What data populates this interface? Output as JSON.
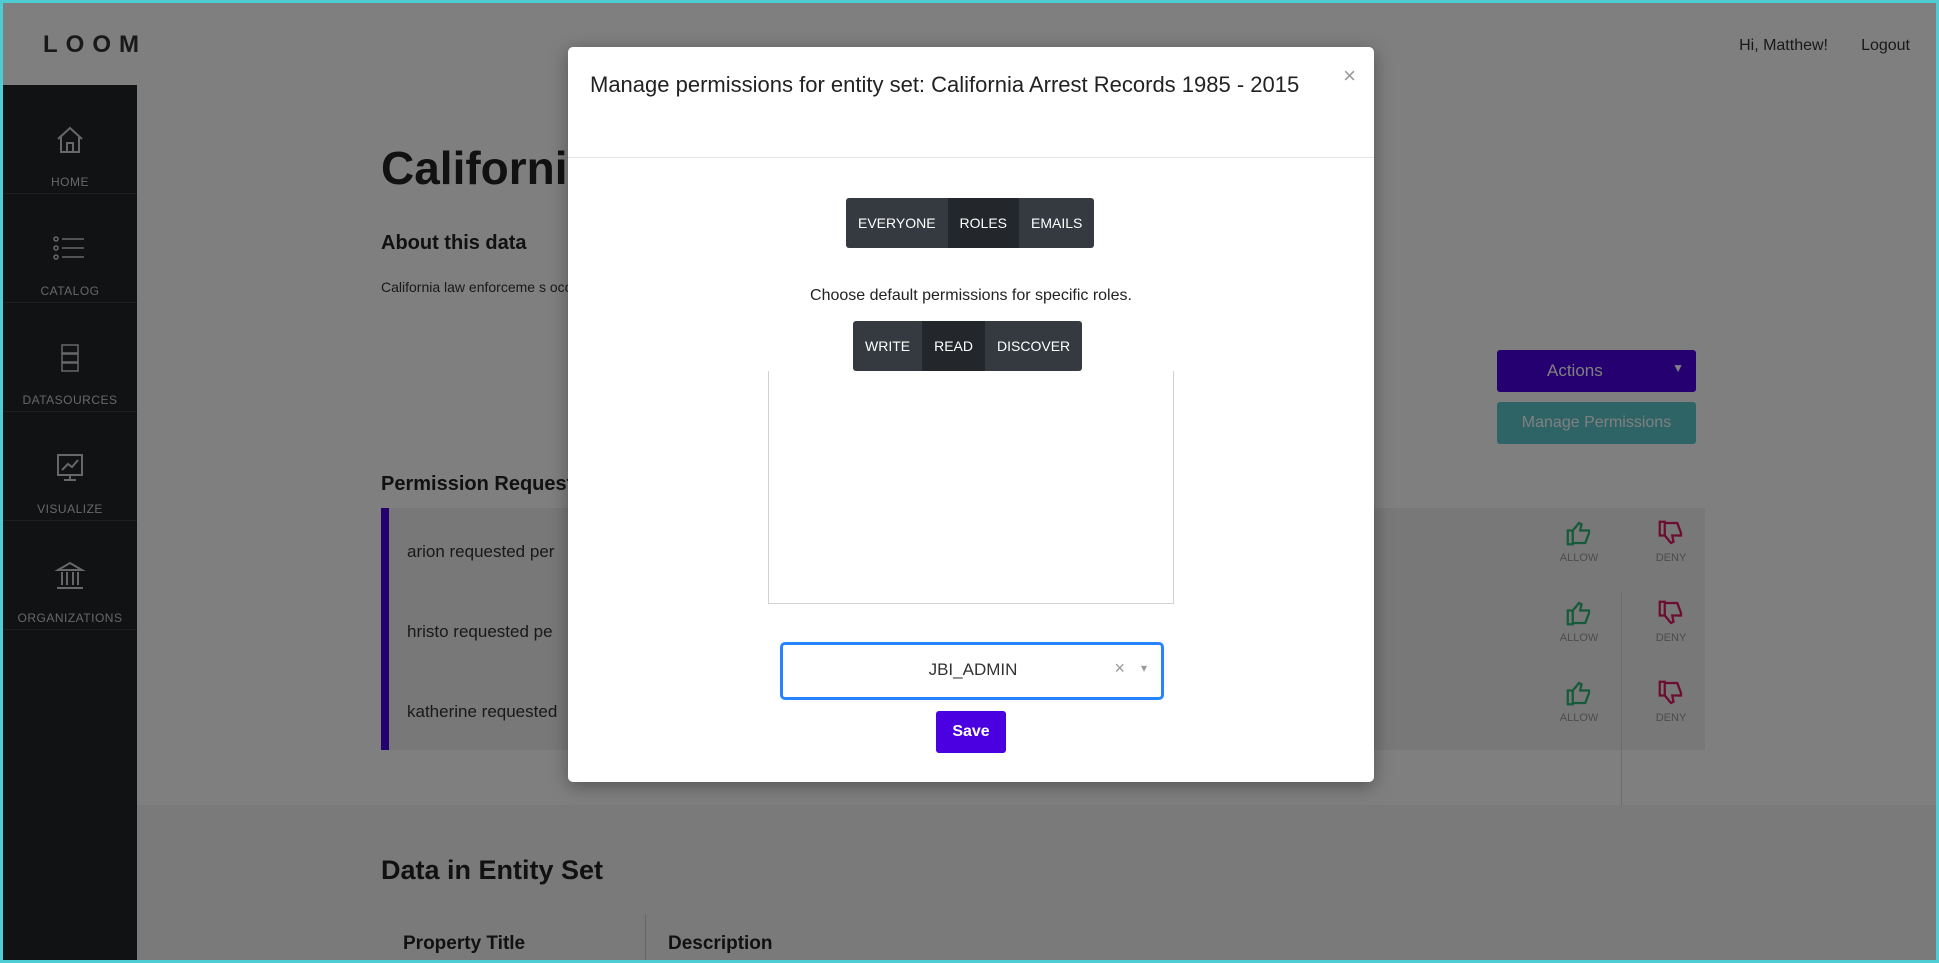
{
  "app": {
    "logo": "LOOM",
    "greeting": "Hi, Matthew!",
    "logout": "Logout"
  },
  "sidebar": {
    "items": [
      {
        "label": "HOME",
        "icon": "home-icon"
      },
      {
        "label": "CATALOG",
        "icon": "catalog-icon"
      },
      {
        "label": "DATASOURCES",
        "icon": "datasources-icon"
      },
      {
        "label": "VISUALIZE",
        "icon": "visualize-icon"
      },
      {
        "label": "ORGANIZATIONS",
        "icon": "organizations-icon"
      }
    ]
  },
  "page": {
    "title": "Californi",
    "about_title": "About this data",
    "description": "California law enforceme                                                                                                                                                 s occurring within the state. This Monthly Arrest and Citation Repo                                                                                                                                         al arrested, and limited information on the law enforcement disposi",
    "actions_label": "Actions",
    "manage_permissions_label": "Manage Permissions",
    "requests_title": "Permission Request",
    "requests": [
      {
        "text": "arion requested per"
      },
      {
        "text": "hristo requested pe"
      },
      {
        "text": "katherine requested"
      }
    ],
    "allow_label": "ALLOW",
    "deny_label": "DENY",
    "data_title": "Data in Entity Set",
    "table_headers": [
      "Property Title",
      "Description"
    ]
  },
  "modal": {
    "title": "Manage permissions for entity set: California Arrest Records 1985 - 2015",
    "close": "×",
    "scope_tabs": [
      "EVERYONE",
      "ROLES",
      "EMAILS"
    ],
    "scope_active": "ROLES",
    "help_text": "Choose default permissions for specific roles.",
    "perm_tabs": [
      "WRITE",
      "READ",
      "DISCOVER"
    ],
    "perm_active": "READ",
    "role_value": "JBI_ADMIN",
    "clear_icon": "×",
    "dropdown_icon": "▾",
    "save_label": "Save"
  },
  "colors": {
    "accent": "#4a00e0",
    "teal": "#5ec8cc",
    "allow": "#2bb673",
    "deny": "#d81b60",
    "sidebar": "#222427"
  }
}
